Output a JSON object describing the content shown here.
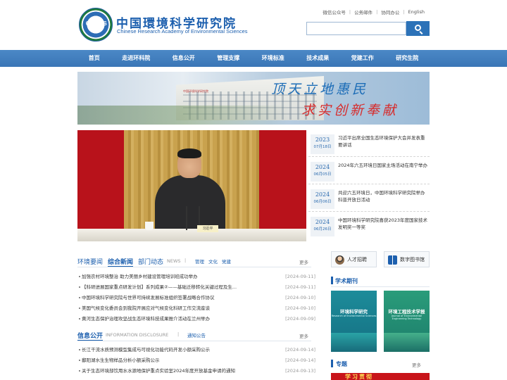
{
  "header": {
    "logo_badge": "CRAES",
    "logo_cn": "中国環境科学研究院",
    "logo_en": "Chinese Research Academy of Environmental Sciences",
    "top_links": [
      "微信公众号",
      "公务邮件",
      "协同办公",
      "English"
    ],
    "search_placeholder": ""
  },
  "nav": {
    "items": [
      "首页",
      "走进环科院",
      "信息公开",
      "管理支撑",
      "环境标准",
      "技术成果",
      "党建工作",
      "研究生院"
    ]
  },
  "banner": {
    "slogan_line1": "顶天立地惠民",
    "slogan_line2": "求实创新奉献",
    "building_sign": "中国环境科学研究院"
  },
  "feature": {
    "nameplate": "习近平"
  },
  "date_news": [
    {
      "year": "2023",
      "md": "07月18日",
      "title": "习近平出席全国生态环境保护大会并发表重要讲话"
    },
    {
      "year": "2024",
      "md": "06月05日",
      "title": "2024年六五环境日国家主场活动在南宁举办"
    },
    {
      "year": "2024",
      "md": "06月06日",
      "title": "共迎六五环境日，中国环境科学研究院举办科普开放日活动"
    },
    {
      "year": "2024",
      "md": "06月26日",
      "title": "中国环境科学研究院喜获2023年度国家技术发明奖一等奖"
    }
  ],
  "news_section": {
    "tabs": [
      "环境要闻",
      "综合新闻",
      "部门动态"
    ],
    "subtitle": "NEWS",
    "subtabs": [
      "管理",
      "文化",
      "党建"
    ],
    "more": "更多",
    "items": [
      {
        "text": "加强农村环境整治 助力美丽乡村建设管理培训班成功举办",
        "date": "[2024-09-11]"
      },
      {
        "text": "【科研进展国家重点研发计划】系列成果②——基础迁移转化关键过程及生...",
        "date": "[2024-09-11]"
      },
      {
        "text": "中国环境科学研究院与世界可持续发展标准组织签署战略合作协议",
        "date": "[2024-09-10]"
      },
      {
        "text": "美国气候变化委员会到我院开展应对气候变化科研工作交流座谈",
        "date": "[2024-09-10]"
      },
      {
        "text": "黄河生态保护治理攻坚战生态环境科技成果推介活动在兰州举办",
        "date": "[2024-09-09]"
      }
    ]
  },
  "info_section": {
    "title": "信息公开",
    "subtitle": "INFORMATION DISCLOSURE",
    "tab": "通知公告",
    "more": "更多",
    "items": [
      {
        "text": "长江干流水质预测模型集成与可视化功能代码开发小额采购公示",
        "date": "[2024-09-14]"
      },
      {
        "text": "鄱阳湖水生生物样品分析小额采购公示",
        "date": "[2024-09-14]"
      },
      {
        "text": "关于生态环境部饮用水水源地保护重点实验室2024年度开放基金申请的通知",
        "date": "[2024-09-13]"
      }
    ]
  },
  "sidebar": {
    "buttons": [
      "人才招聘",
      "数字图书馆"
    ],
    "journals_title": "学术期刊",
    "journals": [
      {
        "title": "环境科学研究",
        "en": "Research of Environmental Sciences"
      },
      {
        "title": "环境工程技术学报",
        "en": "Journal of Environmental Engineering Technology"
      }
    ],
    "topics_title": "专题",
    "topics_more": "更多",
    "topics_strip": "学习贯彻"
  },
  "colors": {
    "brand_blue": "#1c5fae",
    "nav_blue": "#3a76b6",
    "feature_red": "#b8121b"
  }
}
